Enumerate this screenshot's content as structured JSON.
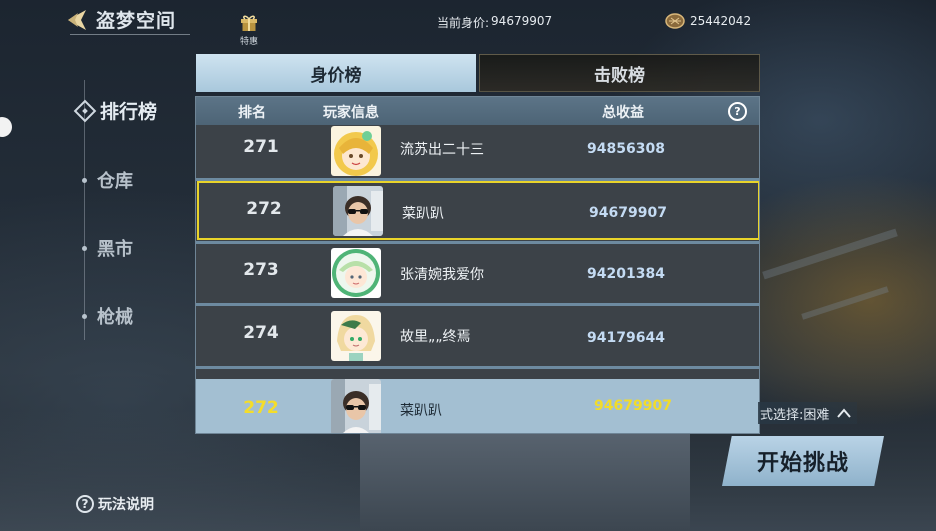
{
  "header": {
    "title": "盗梦空间",
    "deal_label": "特惠",
    "worth_label": "当前身价:",
    "worth_value": "94679907",
    "coins": "25442042"
  },
  "nav": {
    "items": [
      {
        "label": "排行榜",
        "active": true
      },
      {
        "label": "仓库",
        "active": false
      },
      {
        "label": "黑市",
        "active": false
      },
      {
        "label": "枪械",
        "active": false
      }
    ],
    "help": "玩法说明"
  },
  "tabs": {
    "worth": "身价榜",
    "defeat": "击败榜"
  },
  "table": {
    "headers": {
      "rank": "排名",
      "player": "玩家信息",
      "income": "总收益"
    },
    "rows": [
      {
        "rank": "271",
        "name": "流苏出二十三",
        "income": "94856308",
        "avatar": "anime-avatar-yellow"
      },
      {
        "rank": "272",
        "name": "菜趴趴",
        "income": "94679907",
        "avatar": "sunglasses-avatar",
        "highlight": true
      },
      {
        "rank": "273",
        "name": "张清婉我爱你",
        "income": "94201384",
        "avatar": "anime-avatar-green"
      },
      {
        "rank": "274",
        "name": "故里„„终焉",
        "income": "94179644",
        "avatar": "anime-avatar-blonde"
      }
    ],
    "self": {
      "rank": "272",
      "name": "菜趴趴",
      "income": "94679907",
      "avatar": "sunglasses-avatar"
    }
  },
  "footer": {
    "difficulty": "式选择:困难",
    "start_button": "开始挑战"
  },
  "colors": {
    "highlight_border": "#e9d42a",
    "self_rank_text": "#f4dd2a",
    "income_text": "#c4dbf3"
  }
}
